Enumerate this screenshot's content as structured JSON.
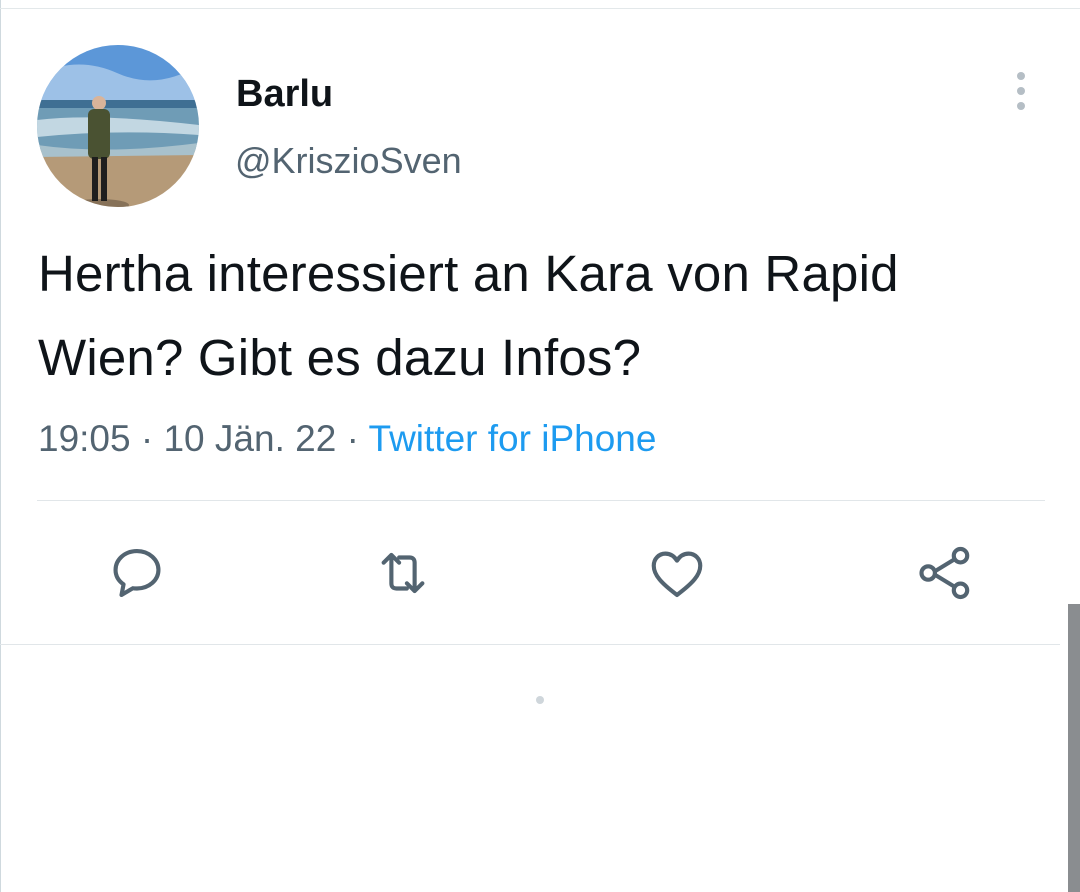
{
  "author": {
    "display_name": "Barlu",
    "handle": "@KriszioSven"
  },
  "tweet": {
    "text": "Hertha interessiert an Kara von Rapid Wien? Gibt es dazu Infos?",
    "time": "19:05",
    "date": "10 Jän. 22",
    "separator": "·",
    "source": "Twitter for iPhone"
  },
  "icons": {
    "more": "more-vertical-icon",
    "reply": "reply-icon",
    "retweet": "retweet-icon",
    "like": "heart-icon",
    "share": "share-icon"
  },
  "colors": {
    "text": "#0f1419",
    "secondary": "#536471",
    "link": "#1d9bf0",
    "icon": "#536471"
  }
}
